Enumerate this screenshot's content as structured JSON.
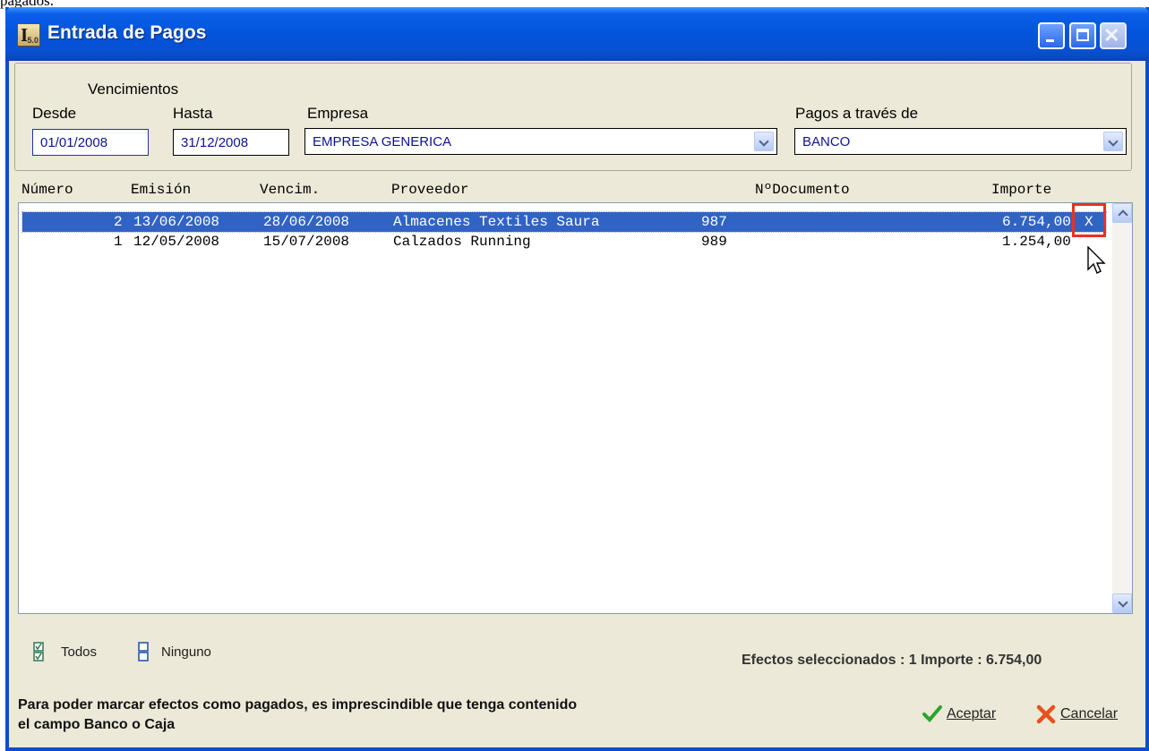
{
  "page_fragment": "pagados.",
  "window": {
    "title": "Entrada de Pagos",
    "icon_label": "5.0"
  },
  "filters": {
    "vencimientos_label": "Vencimientos",
    "desde_label": "Desde",
    "desde_value": "01/01/2008",
    "hasta_label": "Hasta",
    "hasta_value": "31/12/2008",
    "empresa_label": "Empresa",
    "empresa_value": "EMPRESA GENERICA",
    "pagos_label": "Pagos a través de",
    "pagos_value": "BANCO"
  },
  "table": {
    "headers": [
      "Número",
      "Emisión",
      "Vencim.",
      "Proveedor",
      "NºDocumento",
      "Importe"
    ],
    "rows": [
      {
        "numero": "2",
        "emision": "13/06/2008",
        "vencim": "28/06/2008",
        "proveedor": "Almacenes Textiles Saura",
        "documento": "987",
        "importe": "6.754,00",
        "mark": "X",
        "selected": true
      },
      {
        "numero": "1",
        "emision": "12/05/2008",
        "vencim": "15/07/2008",
        "proveedor": "Calzados Running",
        "documento": "989",
        "importe": "1.254,00",
        "mark": "",
        "selected": false
      }
    ]
  },
  "footer": {
    "todos_label": "Todos",
    "ninguno_label": "Ninguno",
    "summary": "Efectos seleccionados : 1 Importe : 6.754,00",
    "note_line1": "Para poder marcar efectos como pagados, es imprescindible que tenga contenido",
    "note_line2": "el campo Banco o Caja",
    "accept_label": "Aceptar",
    "cancel_label": "Cancelar"
  },
  "colors": {
    "selection": "#3163c5",
    "highlight_box": "#e8321e",
    "title_bar": "#0355dc"
  }
}
